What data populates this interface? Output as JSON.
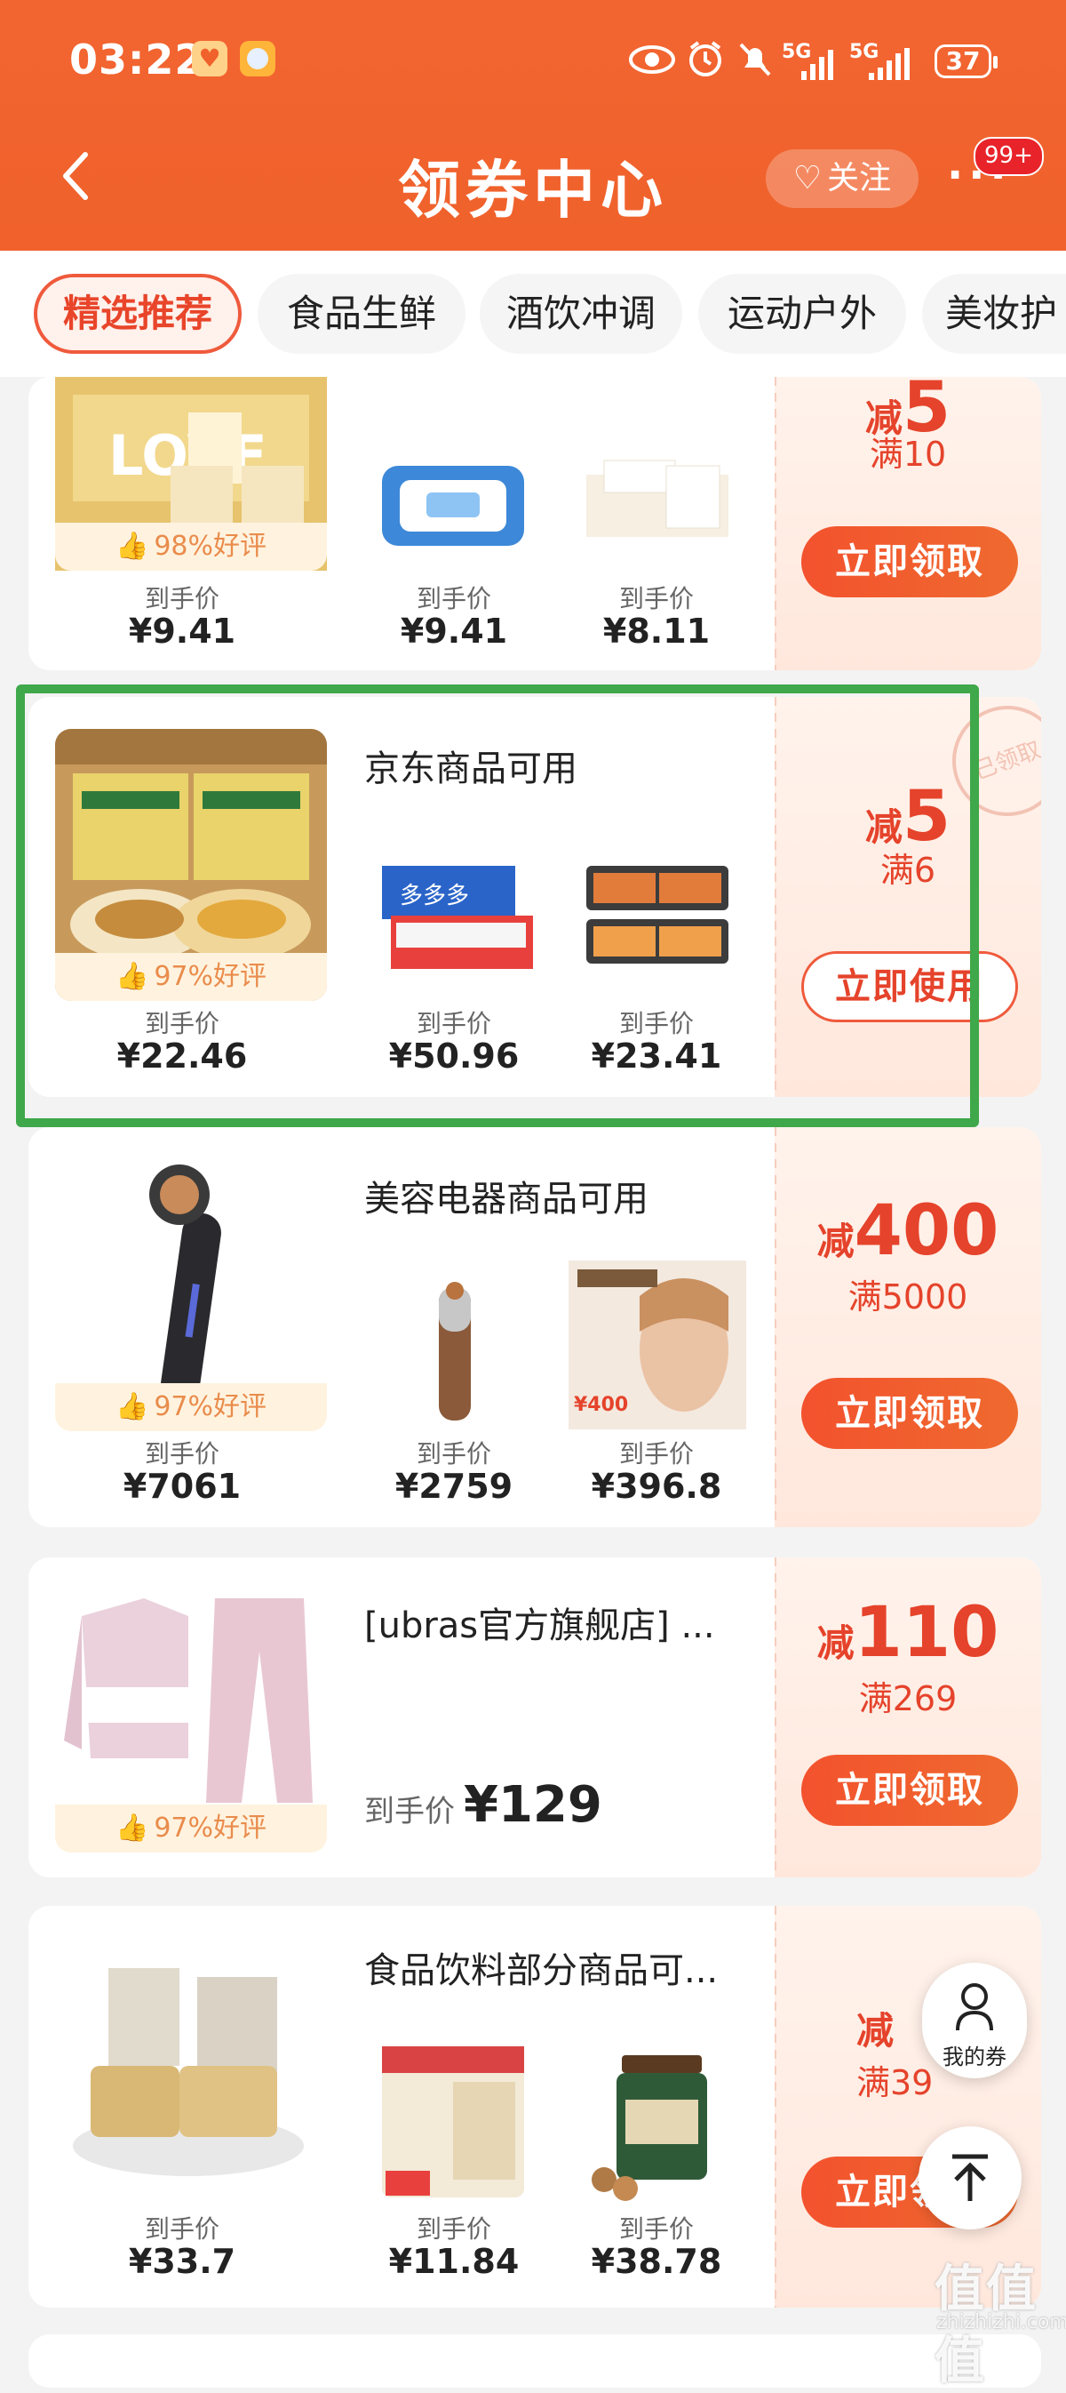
{
  "status": {
    "time": "03:22",
    "net1": "5G",
    "net2": "5G",
    "battery": "37"
  },
  "nav": {
    "title": "领券中心",
    "follow_label": "关注",
    "badge": "99+"
  },
  "tabs": [
    "精选推荐",
    "食品生鲜",
    "酒饮冲调",
    "运动户外",
    "美妆护"
  ],
  "price_label": "到手价",
  "cards": [
    {
      "rating": "98%好评",
      "prices": [
        "¥9.41",
        "¥9.41",
        "¥8.11"
      ],
      "cut_prefix": "减",
      "cut": "5",
      "min": "满10",
      "button": "立即领取"
    },
    {
      "name": "京东商品可用",
      "rating": "97%好评",
      "prices": [
        "¥22.46",
        "¥50.96",
        "¥23.41"
      ],
      "cut_prefix": "减",
      "cut": "5",
      "min": "满6",
      "button": "立即使用",
      "stamp": "已领取"
    },
    {
      "name": "美容电器商品可用",
      "rating": "97%好评",
      "prices": [
        "¥7061",
        "¥2759",
        "¥396.8"
      ],
      "cut_prefix": "减",
      "cut": "400",
      "min": "满5000",
      "button": "立即领取",
      "img_tag": "¥400"
    },
    {
      "name": "[ubras官方旗舰店] ...",
      "rating": "97%好评",
      "price": "¥129",
      "cut_prefix": "减",
      "cut": "110",
      "min": "满269",
      "button": "立即领取"
    },
    {
      "name": "食品饮料部分商品可...",
      "prices": [
        "¥33.7",
        "¥11.84",
        "¥38.78"
      ],
      "cut_prefix": "减",
      "cut": "",
      "min": "满39",
      "button": "立即领取"
    }
  ],
  "floating": {
    "my_coupon": "我的券"
  },
  "watermark": {
    "logo": "值值值",
    "url": "zhizhizhi.com"
  },
  "colors": {
    "brand": "#f0612b",
    "accent": "#e5432b",
    "highlight": "#3fa84a"
  }
}
